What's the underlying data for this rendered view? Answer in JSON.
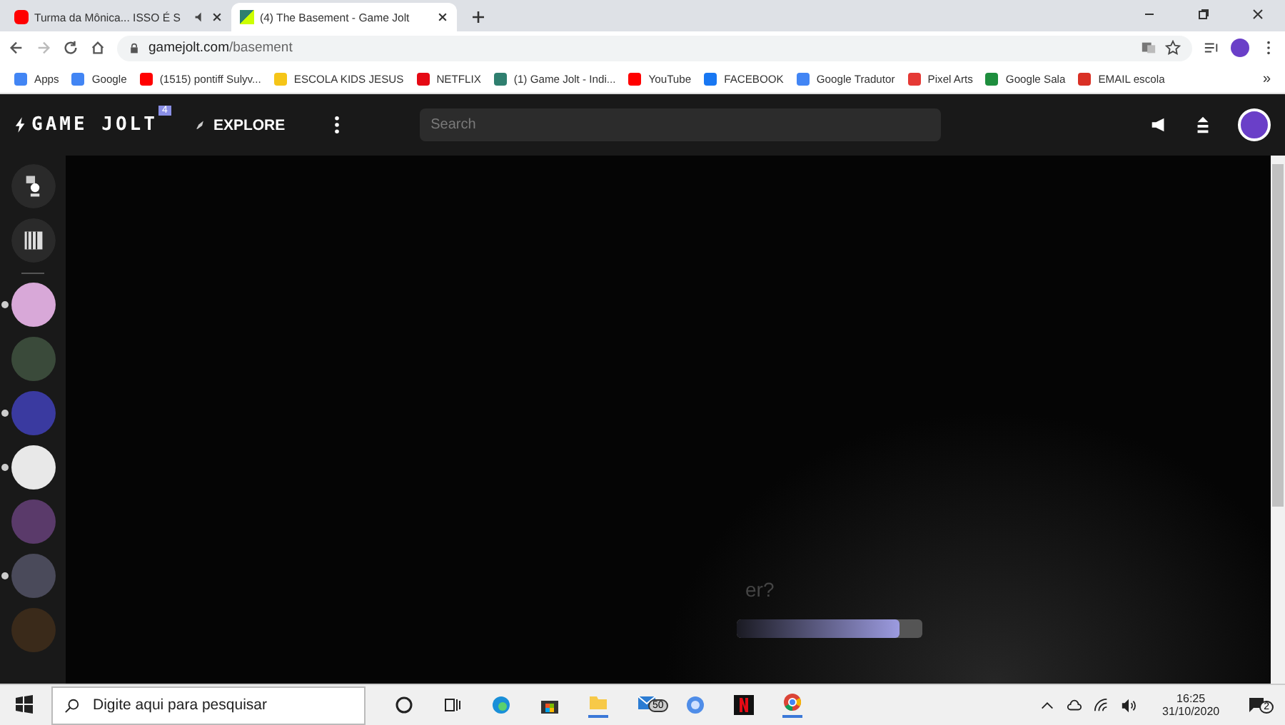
{
  "browser": {
    "tabs": [
      {
        "title": "Turma da Mônica... ISSO É S",
        "selected": false,
        "audio": true
      },
      {
        "title": "(4) The Basement - Game Jolt",
        "selected": true,
        "audio": false
      }
    ],
    "url_host": "gamejolt.com",
    "url_path": "/basement",
    "bookmarks": [
      {
        "label": "Apps",
        "color": "#4285f4"
      },
      {
        "label": "Google",
        "color": "#4285f4"
      },
      {
        "label": "(1515) pontiff Sulyv...",
        "color": "#ff0000"
      },
      {
        "label": "ESCOLA KIDS JESUS",
        "color": "#f5c518"
      },
      {
        "label": "NETFLIX",
        "color": "#e50914"
      },
      {
        "label": "(1) Game Jolt - Indi...",
        "color": "#2f7f6f"
      },
      {
        "label": "YouTube",
        "color": "#ff0000"
      },
      {
        "label": "FACEBOOK",
        "color": "#1877f2"
      },
      {
        "label": "Google Tradutor",
        "color": "#4285f4"
      },
      {
        "label": "Pixel Arts",
        "color": "#e53935"
      },
      {
        "label": "Google Sala",
        "color": "#1e8e3e"
      },
      {
        "label": "EMAIL escola",
        "color": "#d93025"
      }
    ],
    "more": "»"
  },
  "site": {
    "logo": "GAME JOLT",
    "notification_count": "4",
    "explore": "EXPLORE",
    "search": {
      "placeholder": "Search"
    },
    "sidebar": [
      {
        "kind": "icon",
        "unread": false
      },
      {
        "kind": "icon",
        "unread": false
      },
      {
        "kind": "avatar",
        "color": "#d8a8d8",
        "unread": true
      },
      {
        "kind": "avatar",
        "color": "#3a4a3a",
        "unread": false
      },
      {
        "kind": "avatar",
        "color": "#3a3aa0",
        "unread": true
      },
      {
        "kind": "avatar",
        "color": "#e8e8e8",
        "unread": true
      },
      {
        "kind": "avatar",
        "color": "#5a3a6a",
        "unread": false
      },
      {
        "kind": "avatar",
        "color": "#4a4a5a",
        "unread": true
      },
      {
        "kind": "avatar",
        "color": "#3a2a1a",
        "unread": false
      }
    ],
    "prompt": "er?",
    "progress": {
      "level": 0.88
    }
  },
  "taskbar": {
    "search": {
      "placeholder": "Digite aqui para pesquisar"
    },
    "mail_count": "50",
    "time": "16:25",
    "date": "31/10/2020",
    "notifications": "2"
  }
}
